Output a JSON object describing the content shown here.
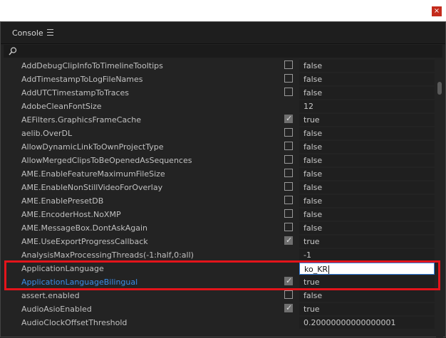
{
  "window": {
    "close_glyph": "×"
  },
  "panel": {
    "title": "Console"
  },
  "search": {
    "placeholder": ""
  },
  "rows": [
    {
      "name": "AddDebugClipInfoToTimelineTooltips",
      "value": "false",
      "has_checkbox": true,
      "checked": false
    },
    {
      "name": "AddTimestampToLogFileNames",
      "value": "false",
      "has_checkbox": true,
      "checked": false
    },
    {
      "name": "AddUTCTimestampToTraces",
      "value": "false",
      "has_checkbox": true,
      "checked": false
    },
    {
      "name": "AdobeCleanFontSize",
      "value": "12",
      "has_checkbox": false,
      "checked": false
    },
    {
      "name": "AEFilters.GraphicsFrameCache",
      "value": "true",
      "has_checkbox": true,
      "checked": true
    },
    {
      "name": "aelib.OverDL",
      "value": "false",
      "has_checkbox": true,
      "checked": false
    },
    {
      "name": "AllowDynamicLinkToOwnProjectType",
      "value": "false",
      "has_checkbox": true,
      "checked": false
    },
    {
      "name": "AllowMergedClipsToBeOpenedAsSequences",
      "value": "false",
      "has_checkbox": true,
      "checked": false
    },
    {
      "name": "AME.EnableFeatureMaximumFileSize",
      "value": "false",
      "has_checkbox": true,
      "checked": false
    },
    {
      "name": "AME.EnableNonStillVideoForOverlay",
      "value": "false",
      "has_checkbox": true,
      "checked": false
    },
    {
      "name": "AME.EnablePresetDB",
      "value": "false",
      "has_checkbox": true,
      "checked": false
    },
    {
      "name": "AME.EncoderHost.NoXMP",
      "value": "false",
      "has_checkbox": true,
      "checked": false
    },
    {
      "name": "AME.MessageBox.DontAskAgain",
      "value": "false",
      "has_checkbox": true,
      "checked": false
    },
    {
      "name": "AME.UseExportProgressCallback",
      "value": "true",
      "has_checkbox": true,
      "checked": true
    },
    {
      "name": "AnalysisMaxProcessingThreads(-1:half,0:all)",
      "value": "-1",
      "has_checkbox": false,
      "checked": false
    },
    {
      "name": "ApplicationLanguage",
      "value": "ko_KR",
      "has_checkbox": false,
      "checked": false,
      "editing": true
    },
    {
      "name": "ApplicationLanguageBilingual",
      "value": "true",
      "has_checkbox": true,
      "checked": true,
      "highlight": true
    },
    {
      "name": "assert.enabled",
      "value": "false",
      "has_checkbox": true,
      "checked": false
    },
    {
      "name": "AudioAsioEnabled",
      "value": "true",
      "has_checkbox": true,
      "checked": true
    },
    {
      "name": "AudioClockOffsetThreshold",
      "value": "0.20000000000000001",
      "has_checkbox": false,
      "checked": false
    }
  ]
}
